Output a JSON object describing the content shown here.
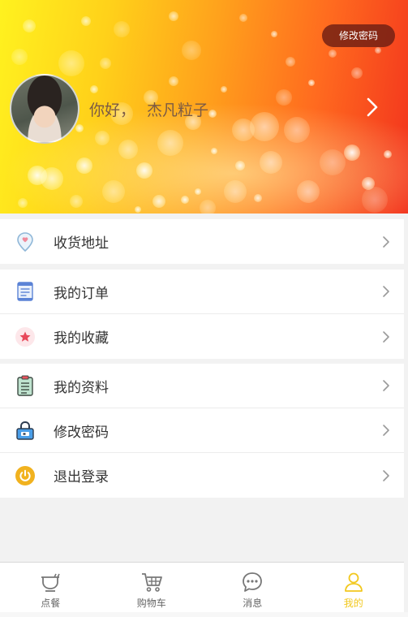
{
  "header": {
    "change_password_button": "修改密码",
    "greeting": "你好，",
    "username": "杰凡粒子"
  },
  "menu_groups": [
    {
      "items": [
        {
          "label": "收货地址",
          "icon": "location-pin-icon"
        }
      ]
    },
    {
      "items": [
        {
          "label": "我的订单",
          "icon": "order-list-icon"
        },
        {
          "label": "我的收藏",
          "icon": "star-icon"
        }
      ]
    },
    {
      "items": [
        {
          "label": "我的资料",
          "icon": "clipboard-icon"
        },
        {
          "label": "修改密码",
          "icon": "lock-icon"
        },
        {
          "label": "退出登录",
          "icon": "power-icon"
        }
      ]
    }
  ],
  "tabbar": {
    "tabs": [
      {
        "label": "点餐",
        "icon": "bowl-icon",
        "active": false
      },
      {
        "label": "购物车",
        "icon": "cart-icon",
        "active": false
      },
      {
        "label": "消息",
        "icon": "chat-icon",
        "active": false
      },
      {
        "label": "我的",
        "icon": "user-icon",
        "active": true
      }
    ],
    "active_color": "#f2c81e",
    "inactive_color": "#666666"
  },
  "colors": {
    "banner_gradient": [
      "#fff21f",
      "#ffa11c",
      "#f2321d"
    ],
    "pill_bg": "#6e1e14",
    "page_bg": "#f2f2f2"
  }
}
